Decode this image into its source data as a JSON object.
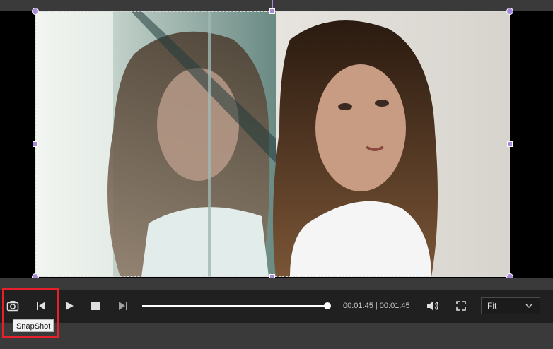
{
  "preview": {
    "image_description_icon": "photo-frame",
    "handle_color": "#a78bda"
  },
  "controls": {
    "snapshot_tooltip": "SnapShot",
    "time_text": "00:01:45 | 00:01:45",
    "progress_fraction": 1.0,
    "fit_label": "Fit",
    "icons": [
      "camera-icon",
      "skip-back-icon",
      "play-icon",
      "stop-icon",
      "skip-forward-icon",
      "volume-icon",
      "fullscreen-icon",
      "chevron-down-icon"
    ],
    "highlight_color": "#e8202a"
  }
}
